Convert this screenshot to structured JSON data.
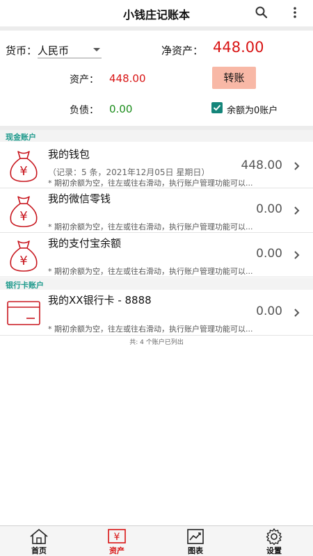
{
  "appbar": {
    "title": "小钱庄记账本",
    "search_icon": "search-icon",
    "more_icon": "more-vertical-icon"
  },
  "summary": {
    "currency_label": "货币：",
    "currency_value": "人民币",
    "net_assets_label": "净资产：",
    "net_assets_value": "448.00",
    "assets_label": "资产：",
    "assets_value": "448.00",
    "transfer_label": "转账",
    "liabilities_label": "负债：",
    "liabilities_value": "0.00",
    "zero_balance_label": "余额为0账户",
    "zero_balance_checked": true
  },
  "sections": {
    "cash": {
      "title": "现金账户",
      "accounts": [
        {
          "name": "我的钱包",
          "detail": "（记录：5 条，2021年12月05日 星期日）",
          "hint": "* 期初余额为空，往左或往右滑动，执行账户管理功能可以...",
          "amount": "448.00",
          "icon": "money-bag-icon"
        },
        {
          "name": "我的微信零钱",
          "hint": "* 期初余额为空，往左或往右滑动，执行账户管理功能可以...",
          "amount": "0.00",
          "icon": "money-bag-icon"
        },
        {
          "name": "我的支付宝余额",
          "hint": "* 期初余额为空，往左或往右滑动，执行账户管理功能可以...",
          "amount": "0.00",
          "icon": "money-bag-icon"
        }
      ]
    },
    "bank": {
      "title": "银行卡账户",
      "accounts": [
        {
          "name": "我的XX银行卡 - 8888",
          "hint": "* 期初余额为空，往左或往右滑动，执行账户管理功能可以...",
          "amount": "0.00",
          "icon": "bank-card-icon"
        }
      ]
    }
  },
  "footer_note": "共: 4 个账户已列出",
  "tabs": [
    {
      "label": "首页",
      "icon": "home-icon",
      "active": false
    },
    {
      "label": "资产",
      "icon": "yuan-icon",
      "active": true
    },
    {
      "label": "图表",
      "icon": "chart-icon",
      "active": false
    },
    {
      "label": "设置",
      "icon": "gear-icon",
      "active": false
    }
  ],
  "colors": {
    "accent_red": "#d81414",
    "positive_green": "#1a8c1a",
    "teal": "#14857a",
    "transfer_button": "#f8b8a6",
    "section_title": "#1e9a8c"
  }
}
